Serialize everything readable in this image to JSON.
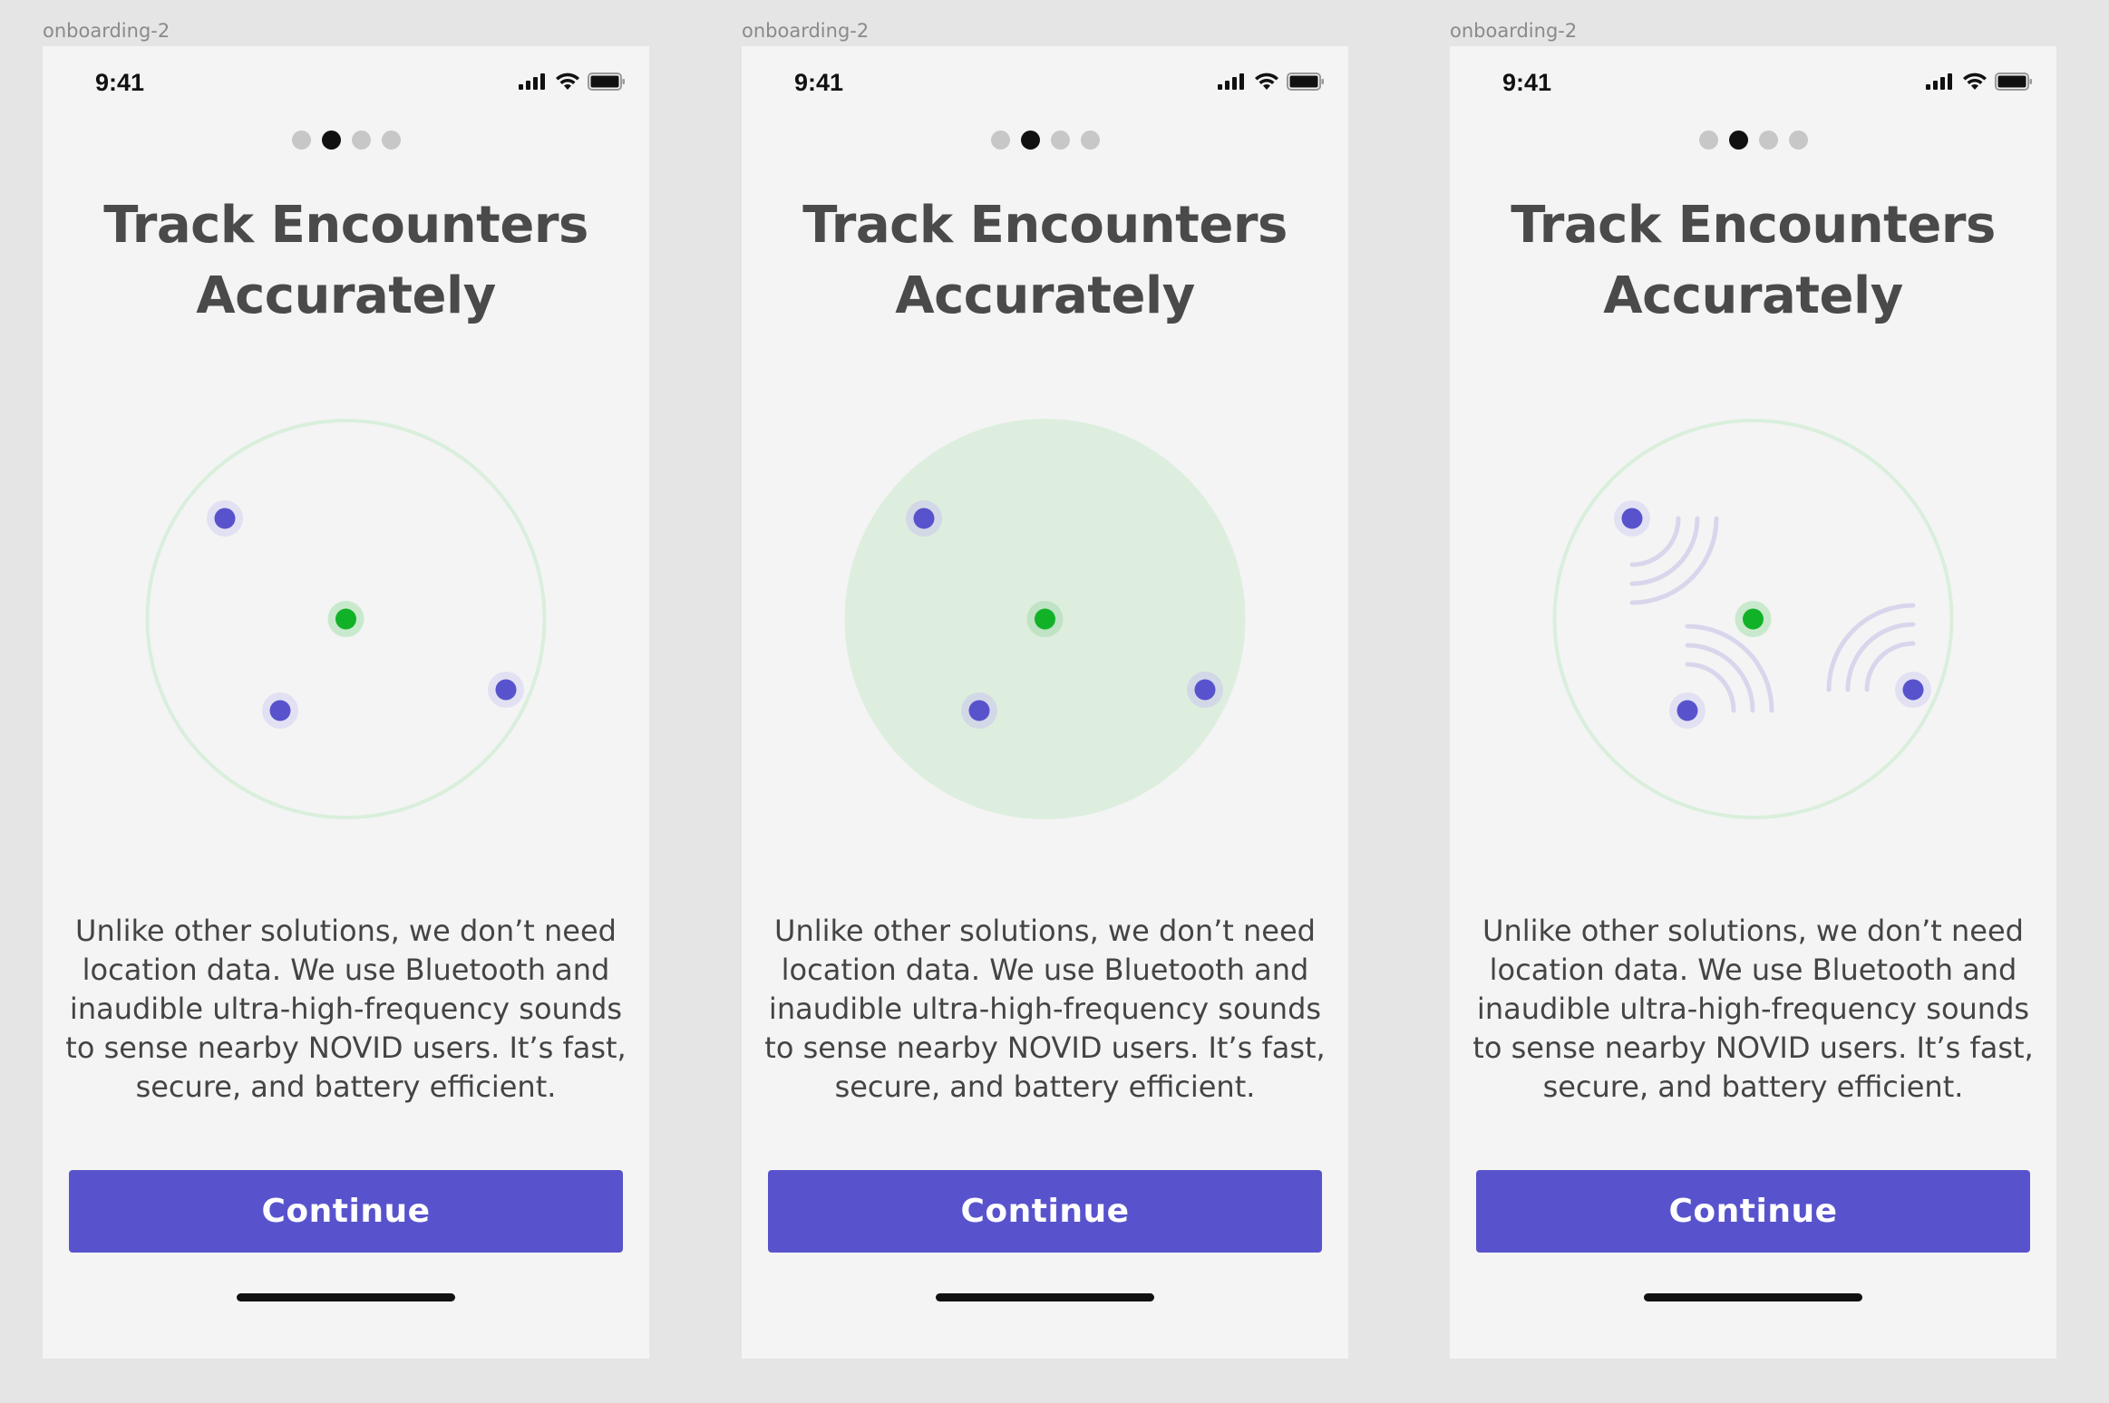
{
  "colors": {
    "canvas": "#e5e5e5",
    "phone_bg": "#f4f4f4",
    "accent": "#5853cc",
    "user_dot": "#5853cc",
    "self_dot": "#12b228",
    "ring": "#d9efdc",
    "fill": "#ddeedf",
    "title": "#4a4a4a",
    "body": "#444444"
  },
  "icons": [
    "signal-icon",
    "wifi-icon",
    "battery-icon"
  ],
  "frames": [
    {
      "frame_label": "onboarding-2",
      "status": {
        "time": "9:41"
      },
      "pager": {
        "total": 4,
        "active": 1
      },
      "title_lines": [
        "Track Encounters",
        "Accurately"
      ],
      "illustration": "ring-outline",
      "body_lines": [
        "Unlike other solutions, we don’t need",
        "location data. We use Bluetooth and",
        "inaudible ultra-high-frequency sounds",
        "to sense nearby NOVID users. It’s fast,",
        "secure, and battery efficient."
      ],
      "continue_label": "Continue"
    },
    {
      "frame_label": "onboarding-2",
      "status": {
        "time": "9:41"
      },
      "pager": {
        "total": 4,
        "active": 1
      },
      "title_lines": [
        "Track Encounters",
        "Accurately"
      ],
      "illustration": "filled-area",
      "body_lines": [
        "Unlike other solutions, we don’t need",
        "location data. We use Bluetooth and",
        "inaudible ultra-high-frequency sounds",
        "to sense nearby NOVID users. It’s fast,",
        "secure, and battery efficient."
      ],
      "continue_label": "Continue"
    },
    {
      "frame_label": "onboarding-2",
      "status": {
        "time": "9:41"
      },
      "pager": {
        "total": 4,
        "active": 1
      },
      "title_lines": [
        "Track Encounters",
        "Accurately"
      ],
      "illustration": "ring-with-sound-waves",
      "body_lines": [
        "Unlike other solutions, we don’t need",
        "location data. We use Bluetooth and",
        "inaudible ultra-high-frequency sounds",
        "to sense nearby NOVID users. It’s fast,",
        "secure, and battery efficient."
      ],
      "continue_label": "Continue"
    }
  ]
}
